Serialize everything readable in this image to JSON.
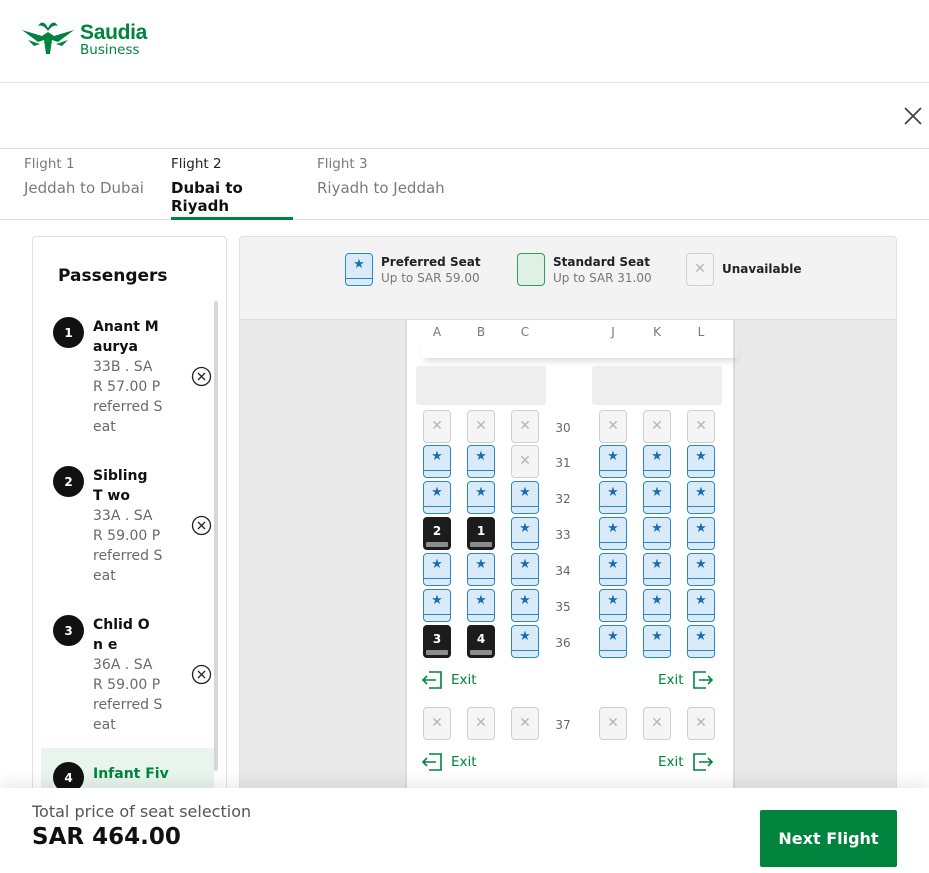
{
  "brand": {
    "name": "Saudia",
    "sub": "Business",
    "color": "#00843d"
  },
  "tabs": [
    {
      "label": "Flight 1",
      "route": "Jeddah to Dubai"
    },
    {
      "label": "Flight 2",
      "route": "Dubai to Riyadh",
      "active": true
    },
    {
      "label": "Flight 3",
      "route": "Riyadh to Jeddah"
    }
  ],
  "passengers": {
    "title": "Passengers",
    "items": [
      {
        "num": "1",
        "name": "Anant M aurya",
        "detail": "33B . SA R  57.00 Preferred Seat"
      },
      {
        "num": "2",
        "name": "Sibling T wo",
        "detail": "33A . SA R  59.00 Preferred Seat"
      },
      {
        "num": "3",
        "name": "Chlid On e",
        "detail": "36A . SA R  59.00 Preferred Seat"
      },
      {
        "num": "4",
        "name": "Infant Fiv"
      }
    ]
  },
  "legend": {
    "preferred": {
      "title": "Preferred Seat",
      "price": "Up to SAR 59.00"
    },
    "standard": {
      "title": "Standard Seat",
      "price": "Up to SAR 31.00"
    },
    "unavailable": {
      "title": "Unavailable"
    }
  },
  "columns": [
    "A",
    "B",
    "C",
    "J",
    "K",
    "L"
  ],
  "rows": [
    {
      "num": "30",
      "seats": [
        "U",
        "U",
        "U",
        "U",
        "U",
        "U"
      ]
    },
    {
      "num": "31",
      "seats": [
        "P",
        "P",
        "U",
        "P",
        "P",
        "P"
      ]
    },
    {
      "num": "32",
      "seats": [
        "P",
        "P",
        "P",
        "P",
        "P",
        "P"
      ]
    },
    {
      "num": "33",
      "seats": [
        "S2",
        "S1",
        "P",
        "P",
        "P",
        "P"
      ]
    },
    {
      "num": "34",
      "seats": [
        "P",
        "P",
        "P",
        "P",
        "P",
        "P"
      ]
    },
    {
      "num": "35",
      "seats": [
        "P",
        "P",
        "P",
        "P",
        "P",
        "P"
      ]
    },
    {
      "num": "36",
      "seats": [
        "S3",
        "S4",
        "P",
        "P",
        "P",
        "P"
      ]
    },
    {
      "num": "37",
      "seats": [
        "U",
        "U",
        "U",
        "U",
        "U",
        "U"
      ]
    }
  ],
  "exit_label": "Exit",
  "footer": {
    "label": "Total price of seat selection",
    "price": "SAR 464.00",
    "button": "Next Flight"
  },
  "colors": {
    "accent": "#00843d",
    "preferred": "#2d86c6",
    "selected": "#1c1c1c"
  }
}
